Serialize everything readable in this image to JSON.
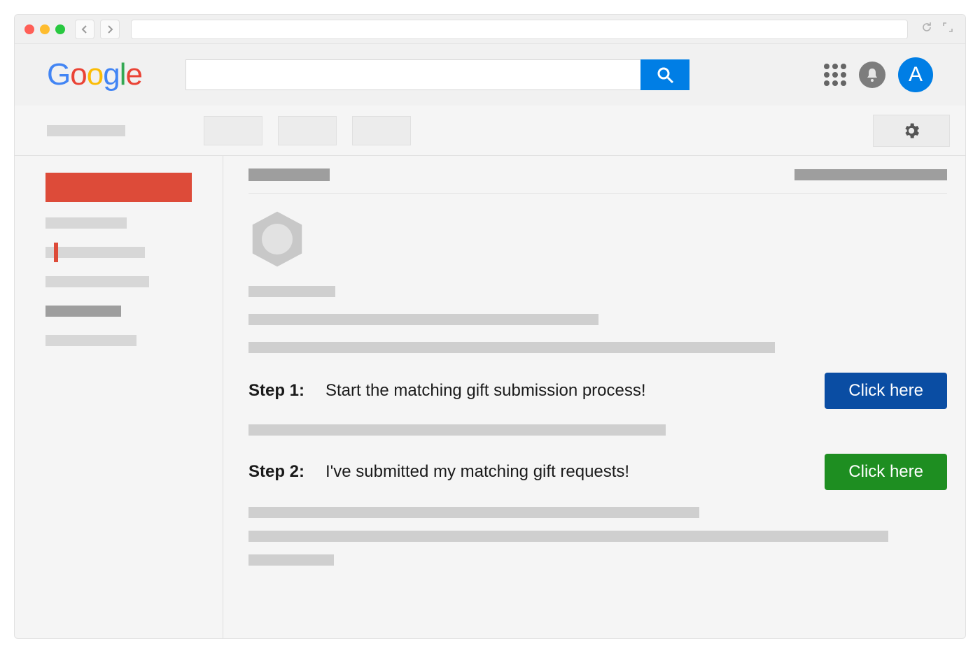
{
  "browser": {
    "url": ""
  },
  "header": {
    "logo_text": "Google",
    "search_placeholder": "",
    "avatar_initial": "A"
  },
  "email": {
    "steps": [
      {
        "label": "Step 1:",
        "text": "Start the matching gift submission process!",
        "cta": "Click here"
      },
      {
        "label": "Step 2:",
        "text": "I've submitted my matching gift requests!",
        "cta": "Click here"
      }
    ]
  }
}
